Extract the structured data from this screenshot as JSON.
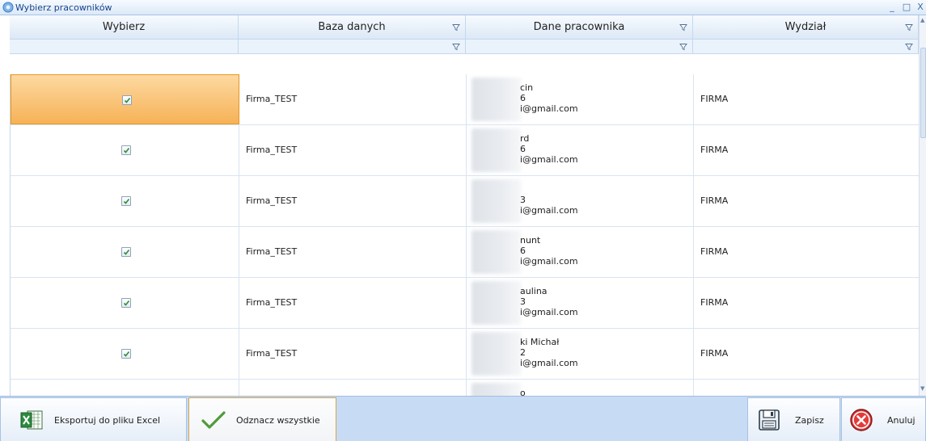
{
  "window": {
    "title": "Wybierz pracowników",
    "controls": [
      "_",
      "□",
      "X"
    ]
  },
  "columns": [
    {
      "title": "Wybierz",
      "filter": false
    },
    {
      "title": "Baza danych",
      "filter": true
    },
    {
      "title": "Dane pracownika",
      "filter": true
    },
    {
      "title": "Wydział",
      "filter": true
    }
  ],
  "rows": [
    {
      "checked": true,
      "selected": true,
      "base": "Firma_TEST",
      "emp": [
        "cin",
        "6",
        "i@gmail.com"
      ],
      "dept": "FIRMA"
    },
    {
      "checked": true,
      "selected": false,
      "base": "Firma_TEST",
      "emp": [
        "rd",
        "6",
        "i@gmail.com"
      ],
      "dept": "FIRMA"
    },
    {
      "checked": true,
      "selected": false,
      "base": "Firma_TEST",
      "emp": [
        "",
        "3",
        "i@gmail.com"
      ],
      "dept": "FIRMA"
    },
    {
      "checked": true,
      "selected": false,
      "base": "Firma_TEST",
      "emp": [
        "nunt",
        "6",
        "i@gmail.com"
      ],
      "dept": "FIRMA"
    },
    {
      "checked": true,
      "selected": false,
      "base": "Firma_TEST",
      "emp": [
        "aulina",
        "3",
        "i@gmail.com"
      ],
      "dept": "FIRMA"
    },
    {
      "checked": true,
      "selected": false,
      "base": "Firma_TEST",
      "emp": [
        "ki Michał",
        "2",
        "i@gmail.com"
      ],
      "dept": "FIRMA"
    },
    {
      "checked": false,
      "selected": false,
      "base": "",
      "emp": [
        "o",
        "",
        ""
      ],
      "dept": ""
    }
  ],
  "footer": {
    "export_label": "Eksportuj do pliku Excel",
    "uncheck_label": "Odznacz wszystkie",
    "save_label": "Zapisz",
    "cancel_label": "Anuluj"
  },
  "colors": {
    "accent": "#f6b257",
    "header": "#dce8f5",
    "footer": "#c7dcf4"
  }
}
